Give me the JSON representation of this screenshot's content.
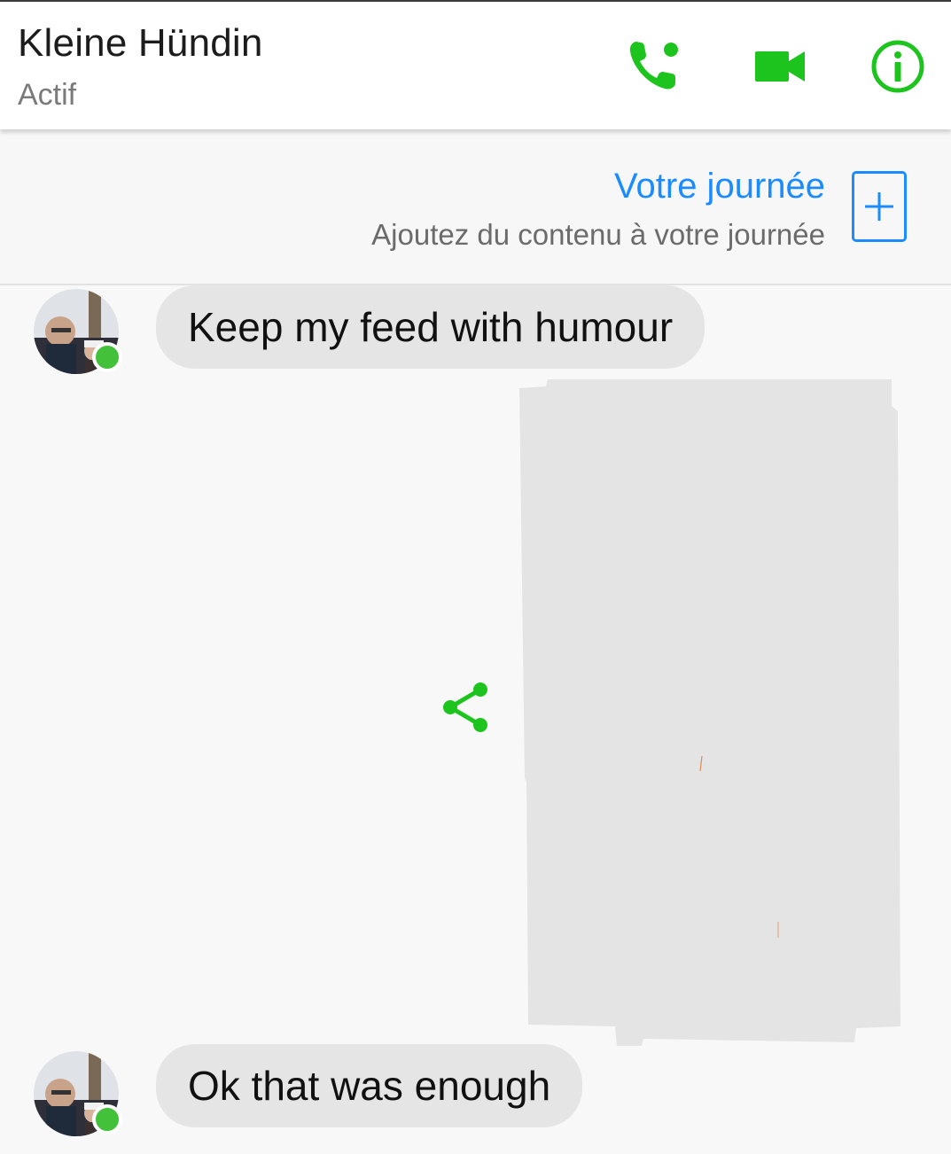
{
  "header": {
    "contact_name": "Kleine Hündin",
    "status": "Actif",
    "icons": [
      "phone-icon",
      "video-camera-icon",
      "info-icon"
    ]
  },
  "story": {
    "title": "Votre journée",
    "subtitle": "Ajoutez du contenu à votre journée",
    "add_icon": "plus-icon"
  },
  "messages": [
    {
      "sender": "contact",
      "text": "Keep my feed with humour"
    },
    {
      "sender": "me",
      "type": "image"
    },
    {
      "sender": "contact",
      "text": "Ok that was enough"
    }
  ],
  "colors": {
    "accent_green": "#1ec41e",
    "link_blue": "#1a8cff",
    "online_green": "#44c13a",
    "bubble_grey": "#e5e5e5"
  }
}
